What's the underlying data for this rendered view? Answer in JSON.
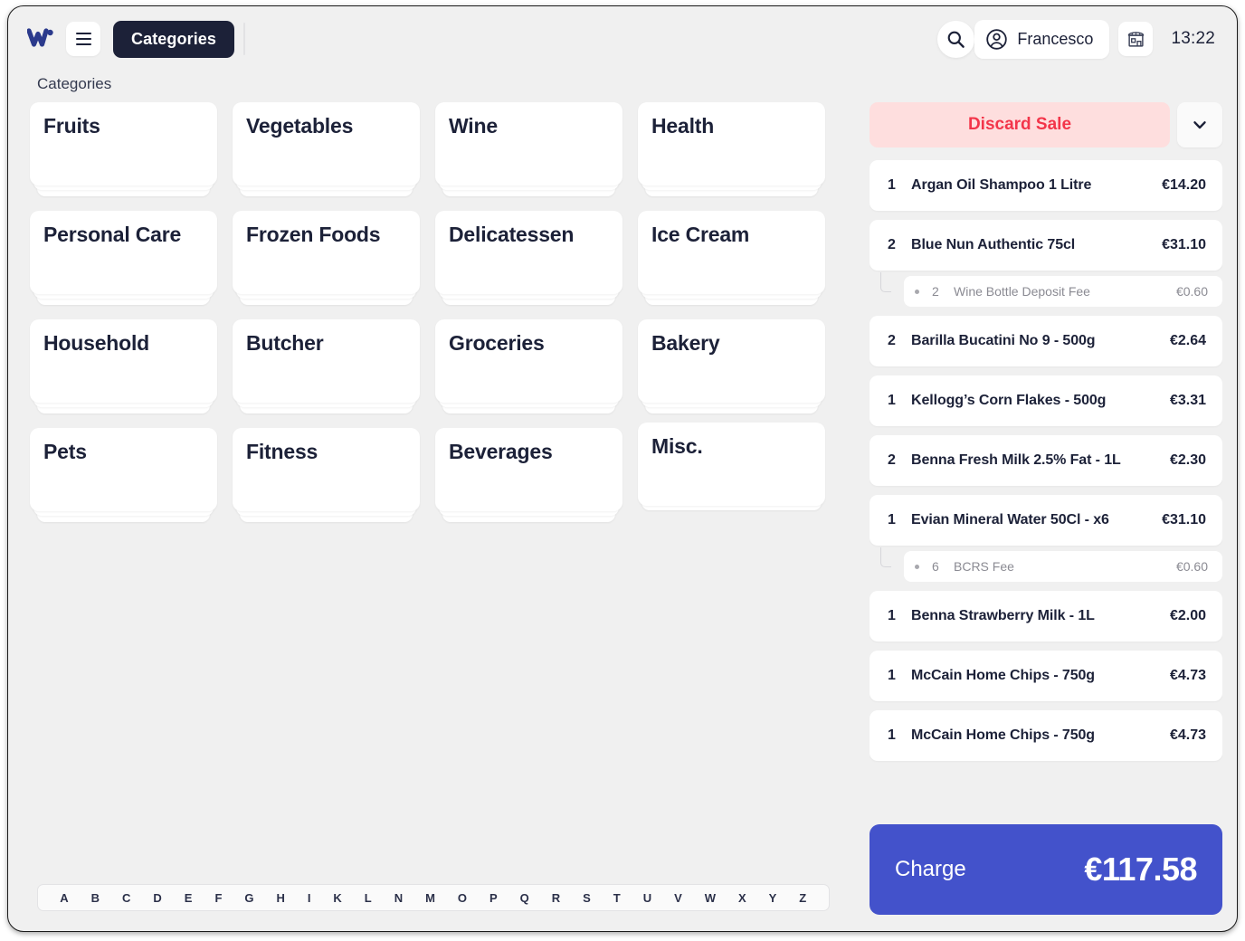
{
  "topbar": {
    "logo_alt": "W logo",
    "menu_label": "menu",
    "active_tab": "Categories",
    "search_label": "search",
    "user_name": "Francesco",
    "store_label": "store",
    "time": "13:22"
  },
  "breadcrumb": "Categories",
  "categories": [
    {
      "label": "Fruits",
      "short": false
    },
    {
      "label": "Vegetables",
      "short": false
    },
    {
      "label": "Wine",
      "short": false
    },
    {
      "label": "Health",
      "short": false
    },
    {
      "label": "Personal Care",
      "short": false
    },
    {
      "label": "Frozen Foods",
      "short": false
    },
    {
      "label": "Delicatessen",
      "short": false
    },
    {
      "label": "Ice Cream",
      "short": false
    },
    {
      "label": "Household",
      "short": false
    },
    {
      "label": "Butcher",
      "short": false
    },
    {
      "label": "Groceries",
      "short": false
    },
    {
      "label": "Bakery",
      "short": false
    },
    {
      "label": "Pets",
      "short": false
    },
    {
      "label": "Fitness",
      "short": false
    },
    {
      "label": "Beverages",
      "short": false
    },
    {
      "label": "Misc.",
      "short": true
    }
  ],
  "alphabet": [
    "A",
    "B",
    "C",
    "D",
    "E",
    "F",
    "G",
    "H",
    "I",
    "K",
    "L",
    "N",
    "M",
    "O",
    "P",
    "Q",
    "R",
    "S",
    "T",
    "U",
    "V",
    "W",
    "X",
    "Y",
    "Z"
  ],
  "cart": {
    "discard_label": "Discard Sale",
    "expand_label": "expand",
    "items": [
      {
        "qty": "1",
        "name": "Argan Oil Shampoo 1 Litre",
        "price": "€14.20",
        "sub": null
      },
      {
        "qty": "2",
        "name": "Blue Nun Authentic 75cl",
        "price": "€31.10",
        "sub": {
          "qty": "2",
          "name": "Wine Bottle Deposit Fee",
          "price": "€0.60"
        }
      },
      {
        "qty": "2",
        "name": "Barilla Bucatini No 9 - 500g",
        "price": "€2.64",
        "sub": null
      },
      {
        "qty": "1",
        "name": "Kellogg’s Corn Flakes - 500g",
        "price": "€3.31",
        "sub": null
      },
      {
        "qty": "2",
        "name": "Benna Fresh Milk 2.5% Fat - 1L",
        "price": "€2.30",
        "sub": null
      },
      {
        "qty": "1",
        "name": "Evian Mineral Water 50Cl - x6",
        "price": "€31.10",
        "sub": {
          "qty": "6",
          "name": "BCRS Fee",
          "price": "€0.60"
        }
      },
      {
        "qty": "1",
        "name": "Benna Strawberry Milk - 1L",
        "price": "€2.00",
        "sub": null
      },
      {
        "qty": "1",
        "name": "McCain Home Chips - 750g",
        "price": "€4.73",
        "sub": null
      },
      {
        "qty": "1",
        "name": "McCain Home Chips - 750g",
        "price": "€4.73",
        "sub": null
      }
    ],
    "charge_label": "Charge",
    "charge_total": "€117.58"
  },
  "colors": {
    "brand_navy": "#1c2138",
    "charge_blue": "#4352cb",
    "discard_bg": "#fedede",
    "discard_text": "#f3354a",
    "app_bg": "#f0f0f0"
  }
}
